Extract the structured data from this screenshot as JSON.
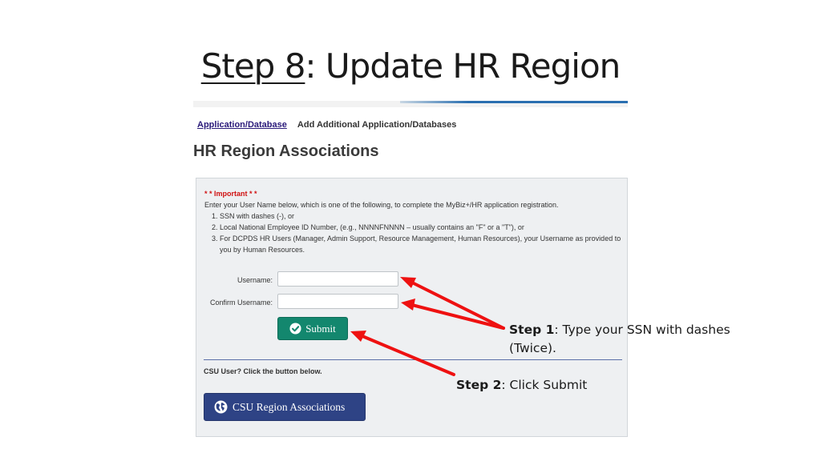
{
  "slide": {
    "title_underlined": "Step 8",
    "title_rest": ": Update HR Region"
  },
  "nav": {
    "link": "Application/Database",
    "item": "Add Additional Application/Databases"
  },
  "page_heading": "HR Region Associations",
  "notice": {
    "important": "* * Important * *",
    "intro": "Enter your User Name below, which is one of the following, to complete the MyBiz+/HR application registration.",
    "items": [
      "SSN with dashes (-), or",
      "Local National Employee ID Number, (e.g., NNNNFNNNN – usually contains an \"F\" or a \"T\"), or",
      "For DCPDS HR Users (Manager, Admin Support, Resource Management, Human Resources), your Username as provided to you by Human Resources."
    ]
  },
  "form": {
    "username_label": "Username:",
    "username_value": "",
    "confirm_label": "Confirm Username:",
    "confirm_value": "",
    "submit_label": "Submit"
  },
  "csu": {
    "prompt": "CSU User? Click the button below.",
    "button_label": "CSU Region Associations"
  },
  "callouts": {
    "step1_bold": "Step 1",
    "step1_text": ": Type your SSN with dashes",
    "step1_text2": "(Twice).",
    "step2_bold": "Step 2",
    "step2_text": ": Click Submit"
  },
  "colors": {
    "arrow": "#ee1111",
    "submit_bg": "#13876e",
    "csu_bg": "#2e4385"
  },
  "icons": {
    "submit": "check-circle-icon",
    "csu": "globe-icon"
  }
}
